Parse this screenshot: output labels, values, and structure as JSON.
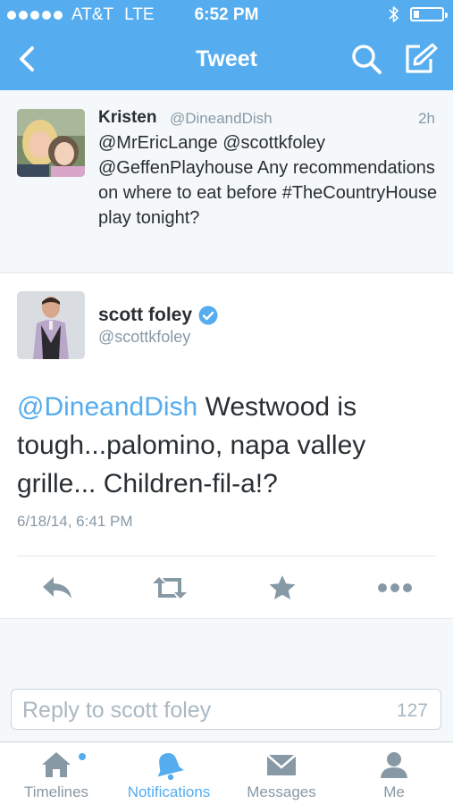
{
  "status_bar": {
    "carrier": "AT&T",
    "network": "LTE",
    "time": "6:52 PM",
    "battery_level": 0.2
  },
  "nav": {
    "title": "Tweet"
  },
  "reply_to_tweet": {
    "name": "Kristen",
    "handle": "@DineandDish",
    "time_ago": "2h",
    "text": "@MrEricLange @scottkfoley @GeffenPlayhouse Any recommendations on where to eat before #TheCountryHouse play tonight?"
  },
  "main_tweet": {
    "name": "scott foley",
    "handle": "@scottkfoley",
    "mention": "@DineandDish",
    "text": " Westwood is tough...palomino, napa valley grille... Children-fil-a!?",
    "date": "6/18/14, 6:41 PM"
  },
  "reply_box": {
    "placeholder": "Reply to scott foley",
    "char_count": "127"
  },
  "tabs": [
    {
      "label": "Timelines",
      "icon": "home-icon"
    },
    {
      "label": "Notifications",
      "icon": "bell-icon"
    },
    {
      "label": "Messages",
      "icon": "envelope-icon"
    },
    {
      "label": "Me",
      "icon": "person-icon"
    }
  ],
  "colors": {
    "brand": "#55acee",
    "text": "#292f33",
    "muted": "#8899a6",
    "icon_gray": "#8899a6",
    "verified": "#55acee"
  }
}
